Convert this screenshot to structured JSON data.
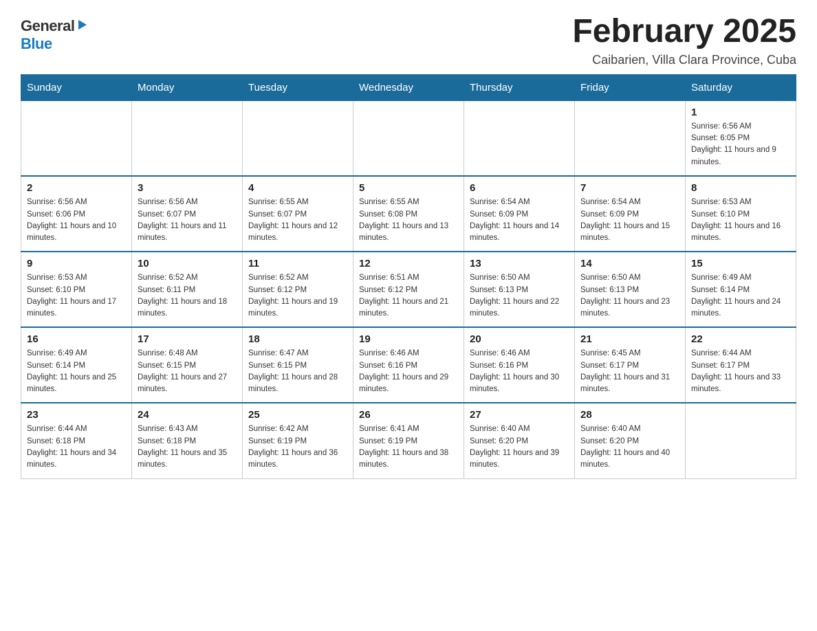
{
  "logo": {
    "general": "General",
    "blue": "Blue",
    "arrow": "▶"
  },
  "title": "February 2025",
  "subtitle": "Caibarien, Villa Clara Province, Cuba",
  "days_of_week": [
    "Sunday",
    "Monday",
    "Tuesday",
    "Wednesday",
    "Thursday",
    "Friday",
    "Saturday"
  ],
  "weeks": [
    [
      {
        "day": "",
        "info": ""
      },
      {
        "day": "",
        "info": ""
      },
      {
        "day": "",
        "info": ""
      },
      {
        "day": "",
        "info": ""
      },
      {
        "day": "",
        "info": ""
      },
      {
        "day": "",
        "info": ""
      },
      {
        "day": "1",
        "info": "Sunrise: 6:56 AM\nSunset: 6:05 PM\nDaylight: 11 hours and 9 minutes."
      }
    ],
    [
      {
        "day": "2",
        "info": "Sunrise: 6:56 AM\nSunset: 6:06 PM\nDaylight: 11 hours and 10 minutes."
      },
      {
        "day": "3",
        "info": "Sunrise: 6:56 AM\nSunset: 6:07 PM\nDaylight: 11 hours and 11 minutes."
      },
      {
        "day": "4",
        "info": "Sunrise: 6:55 AM\nSunset: 6:07 PM\nDaylight: 11 hours and 12 minutes."
      },
      {
        "day": "5",
        "info": "Sunrise: 6:55 AM\nSunset: 6:08 PM\nDaylight: 11 hours and 13 minutes."
      },
      {
        "day": "6",
        "info": "Sunrise: 6:54 AM\nSunset: 6:09 PM\nDaylight: 11 hours and 14 minutes."
      },
      {
        "day": "7",
        "info": "Sunrise: 6:54 AM\nSunset: 6:09 PM\nDaylight: 11 hours and 15 minutes."
      },
      {
        "day": "8",
        "info": "Sunrise: 6:53 AM\nSunset: 6:10 PM\nDaylight: 11 hours and 16 minutes."
      }
    ],
    [
      {
        "day": "9",
        "info": "Sunrise: 6:53 AM\nSunset: 6:10 PM\nDaylight: 11 hours and 17 minutes."
      },
      {
        "day": "10",
        "info": "Sunrise: 6:52 AM\nSunset: 6:11 PM\nDaylight: 11 hours and 18 minutes."
      },
      {
        "day": "11",
        "info": "Sunrise: 6:52 AM\nSunset: 6:12 PM\nDaylight: 11 hours and 19 minutes."
      },
      {
        "day": "12",
        "info": "Sunrise: 6:51 AM\nSunset: 6:12 PM\nDaylight: 11 hours and 21 minutes."
      },
      {
        "day": "13",
        "info": "Sunrise: 6:50 AM\nSunset: 6:13 PM\nDaylight: 11 hours and 22 minutes."
      },
      {
        "day": "14",
        "info": "Sunrise: 6:50 AM\nSunset: 6:13 PM\nDaylight: 11 hours and 23 minutes."
      },
      {
        "day": "15",
        "info": "Sunrise: 6:49 AM\nSunset: 6:14 PM\nDaylight: 11 hours and 24 minutes."
      }
    ],
    [
      {
        "day": "16",
        "info": "Sunrise: 6:49 AM\nSunset: 6:14 PM\nDaylight: 11 hours and 25 minutes."
      },
      {
        "day": "17",
        "info": "Sunrise: 6:48 AM\nSunset: 6:15 PM\nDaylight: 11 hours and 27 minutes."
      },
      {
        "day": "18",
        "info": "Sunrise: 6:47 AM\nSunset: 6:15 PM\nDaylight: 11 hours and 28 minutes."
      },
      {
        "day": "19",
        "info": "Sunrise: 6:46 AM\nSunset: 6:16 PM\nDaylight: 11 hours and 29 minutes."
      },
      {
        "day": "20",
        "info": "Sunrise: 6:46 AM\nSunset: 6:16 PM\nDaylight: 11 hours and 30 minutes."
      },
      {
        "day": "21",
        "info": "Sunrise: 6:45 AM\nSunset: 6:17 PM\nDaylight: 11 hours and 31 minutes."
      },
      {
        "day": "22",
        "info": "Sunrise: 6:44 AM\nSunset: 6:17 PM\nDaylight: 11 hours and 33 minutes."
      }
    ],
    [
      {
        "day": "23",
        "info": "Sunrise: 6:44 AM\nSunset: 6:18 PM\nDaylight: 11 hours and 34 minutes."
      },
      {
        "day": "24",
        "info": "Sunrise: 6:43 AM\nSunset: 6:18 PM\nDaylight: 11 hours and 35 minutes."
      },
      {
        "day": "25",
        "info": "Sunrise: 6:42 AM\nSunset: 6:19 PM\nDaylight: 11 hours and 36 minutes."
      },
      {
        "day": "26",
        "info": "Sunrise: 6:41 AM\nSunset: 6:19 PM\nDaylight: 11 hours and 38 minutes."
      },
      {
        "day": "27",
        "info": "Sunrise: 6:40 AM\nSunset: 6:20 PM\nDaylight: 11 hours and 39 minutes."
      },
      {
        "day": "28",
        "info": "Sunrise: 6:40 AM\nSunset: 6:20 PM\nDaylight: 11 hours and 40 minutes."
      },
      {
        "day": "",
        "info": ""
      }
    ]
  ]
}
